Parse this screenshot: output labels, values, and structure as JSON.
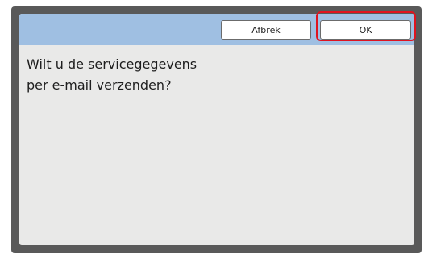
{
  "dialog": {
    "message": "Wilt u de servicegegevens\nper e-mail verzenden?",
    "cancel_label": "Afbrek",
    "ok_label": "OK"
  },
  "colors": {
    "header_bar": "#9fbfe2",
    "dialog_background": "#e9e9e8",
    "frame": "#595959",
    "highlight": "#e0131f"
  }
}
